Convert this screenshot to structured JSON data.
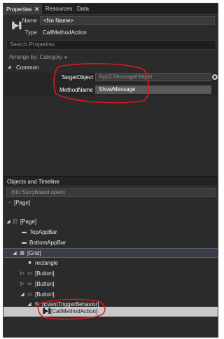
{
  "tabs": [
    {
      "label": "Properties",
      "active": true,
      "closable": true
    },
    {
      "label": "Resources",
      "active": false
    },
    {
      "label": "Data",
      "active": false
    }
  ],
  "header": {
    "name_label": "Name",
    "name_value": "<No Name>",
    "type_label": "Type",
    "type_value": "CallMethodAction"
  },
  "search": {
    "placeholder": "Search Properties"
  },
  "arrange": {
    "label": "Arrange by: Category"
  },
  "common": {
    "title": "Common",
    "properties": [
      {
        "label": "TargetObject",
        "value": "App3.MessageHelper"
      },
      {
        "label": "MethodName",
        "value": "ShowMessage"
      }
    ]
  },
  "objects_timeline": {
    "title": "Objects and Timeline",
    "storyboard": "(No Storyboard open)",
    "page_root": "[Page]",
    "tree": [
      {
        "label": "[Page]",
        "expander": "open",
        "icon": "page-icon"
      },
      {
        "label": "TopAppBar",
        "expander": "none",
        "icon": "appbar-icon"
      },
      {
        "label": "BottomAppBar",
        "expander": "none",
        "icon": "appbar-icon"
      },
      {
        "label": "[Grid]",
        "expander": "open",
        "icon": "grid-icon",
        "selected": true
      },
      {
        "label": "rectangle",
        "expander": "none",
        "icon": "rectangle-icon"
      },
      {
        "label": "[Button]",
        "expander": "closed",
        "icon": "button-icon"
      },
      {
        "label": "[Button]",
        "expander": "closed",
        "icon": "button-icon"
      },
      {
        "label": "[Button]",
        "expander": "open",
        "icon": "button-icon"
      },
      {
        "label": "[EventTriggerBehavior]",
        "expander": "open",
        "icon": "behavior-icon"
      },
      {
        "label": "[CallMethodAction]",
        "expander": "none",
        "icon": "action-icon",
        "highlighted": true
      }
    ]
  },
  "colors": {
    "panel_bg": "#2b2b2b",
    "selection_bg": "#c8c8c8",
    "annotation_red": "#e01818"
  }
}
